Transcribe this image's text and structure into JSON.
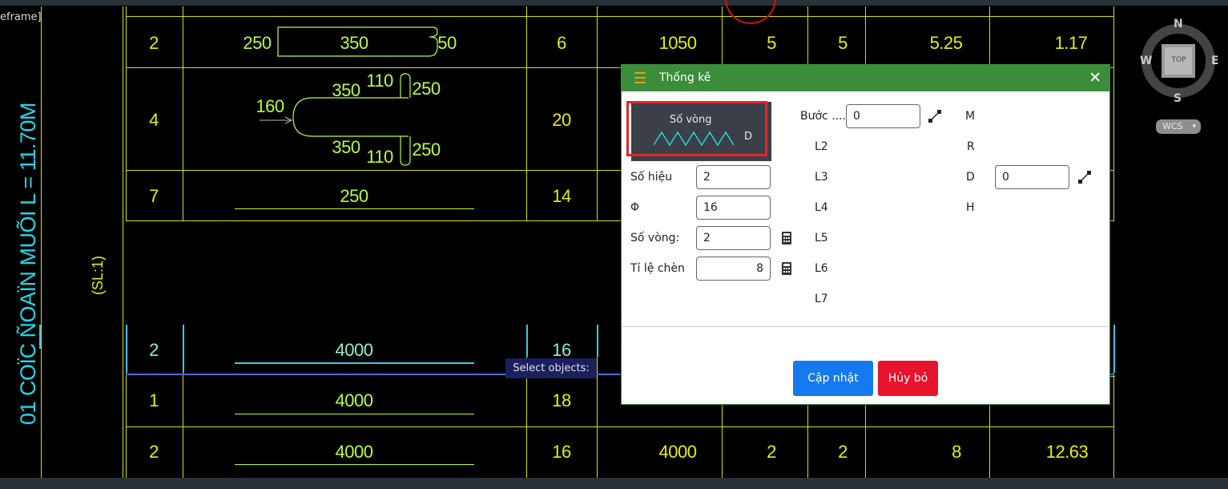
{
  "viewport": {
    "label": "eframe]"
  },
  "drawing": {
    "title": "01 COÏC ÑOAÏN MUÕI L = 11.70M",
    "subtitle": "(SL:1)",
    "rows": [
      {
        "so_hieu": "2",
        "c_len": "250",
        "c_mid": "350",
        "c_end": "50",
        "qty": "6",
        "len": "1050",
        "a": "5",
        "b": "5",
        "c": "5.25",
        "d": "1.17"
      },
      {
        "so_hieu": "4",
        "s1": "350",
        "s2": "110",
        "s3": "250",
        "s4": "160",
        "s5": "350",
        "s6": "110",
        "s7": "250",
        "qty": "20"
      },
      {
        "so_hieu": "7",
        "mid": "250",
        "qty": "14"
      },
      {
        "so_hieu": "2",
        "mid": "4000",
        "qty": "16"
      },
      {
        "so_hieu": "1",
        "mid": "4000",
        "qty": "18"
      },
      {
        "so_hieu": "2",
        "mid": "4000",
        "qty": "16",
        "len": "4000",
        "a": "2",
        "b": "2",
        "c": "8",
        "d": "12.63"
      }
    ],
    "command_prompt": "Select objects:"
  },
  "viewcube": {
    "north": "N",
    "south": "S",
    "east": "E",
    "west": "W",
    "top": "TOP",
    "wcs": "WCS"
  },
  "dialog": {
    "title": "Thống kê",
    "close": "✕",
    "preview": {
      "title": "Số vòng",
      "letter": "D"
    },
    "fields": {
      "so_hieu": {
        "label": "Số hiệu",
        "value": "2"
      },
      "phi": {
        "label": "Φ",
        "value": "16"
      },
      "so_vong": {
        "label": "Số vòng:",
        "value": "2"
      },
      "ti_le_chen": {
        "label": "Tỉ lệ chèn",
        "value": "8"
      },
      "buoc": {
        "label": "Bước ....",
        "value": "0"
      },
      "d": {
        "label": "D",
        "value": "0"
      }
    },
    "col2_labels": [
      "L2",
      "L3",
      "L4",
      "L5",
      "L6",
      "L7"
    ],
    "col3_labels": {
      "m": "M",
      "r": "R",
      "h": "H"
    },
    "buttons": {
      "update": "Cập nhật",
      "cancel": "Hủy bỏ"
    },
    "colors": {
      "title_bar": "#3c8d3a",
      "update": "#1479ef",
      "cancel": "#e8132c",
      "highlight": "#e3242b"
    }
  }
}
